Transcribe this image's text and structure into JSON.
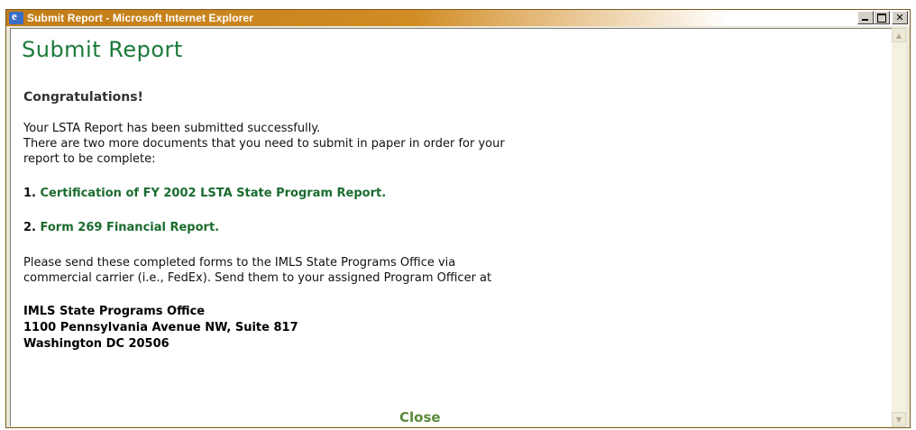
{
  "window": {
    "title": "Submit Report - Microsoft Internet Explorer",
    "icon": "ie-icon",
    "controls": [
      "minimize",
      "maximize",
      "close"
    ]
  },
  "page": {
    "title": "Submit Report",
    "heading": "Congratulations!",
    "intro_line1": "Your LSTA Report has been submitted successfully.",
    "intro_line2": "There are two more documents that you need to submit in paper in order for your",
    "intro_line3": "report to be complete:",
    "items": [
      {
        "number": "1.",
        "label": "Certification of FY 2002 LSTA State Program Report."
      },
      {
        "number": "2.",
        "label": "Form 269 Financial Report."
      }
    ],
    "instructions_line1": "Please send these completed forms to the IMLS State Programs Office via",
    "instructions_line2": "commercial carrier (i.e., FedEx). Send them to your assigned Program Officer at",
    "address": [
      "IMLS State Programs Office",
      "1100 Pennsylvania Avenue NW, Suite 817",
      "Washington DC 20506"
    ],
    "close_label": "Close"
  },
  "colors": {
    "title_green": "#1a7a3a",
    "link_green": "#1a6b2e",
    "close_green": "#5a8a3a",
    "titlebar_orange": "#c27c17"
  }
}
